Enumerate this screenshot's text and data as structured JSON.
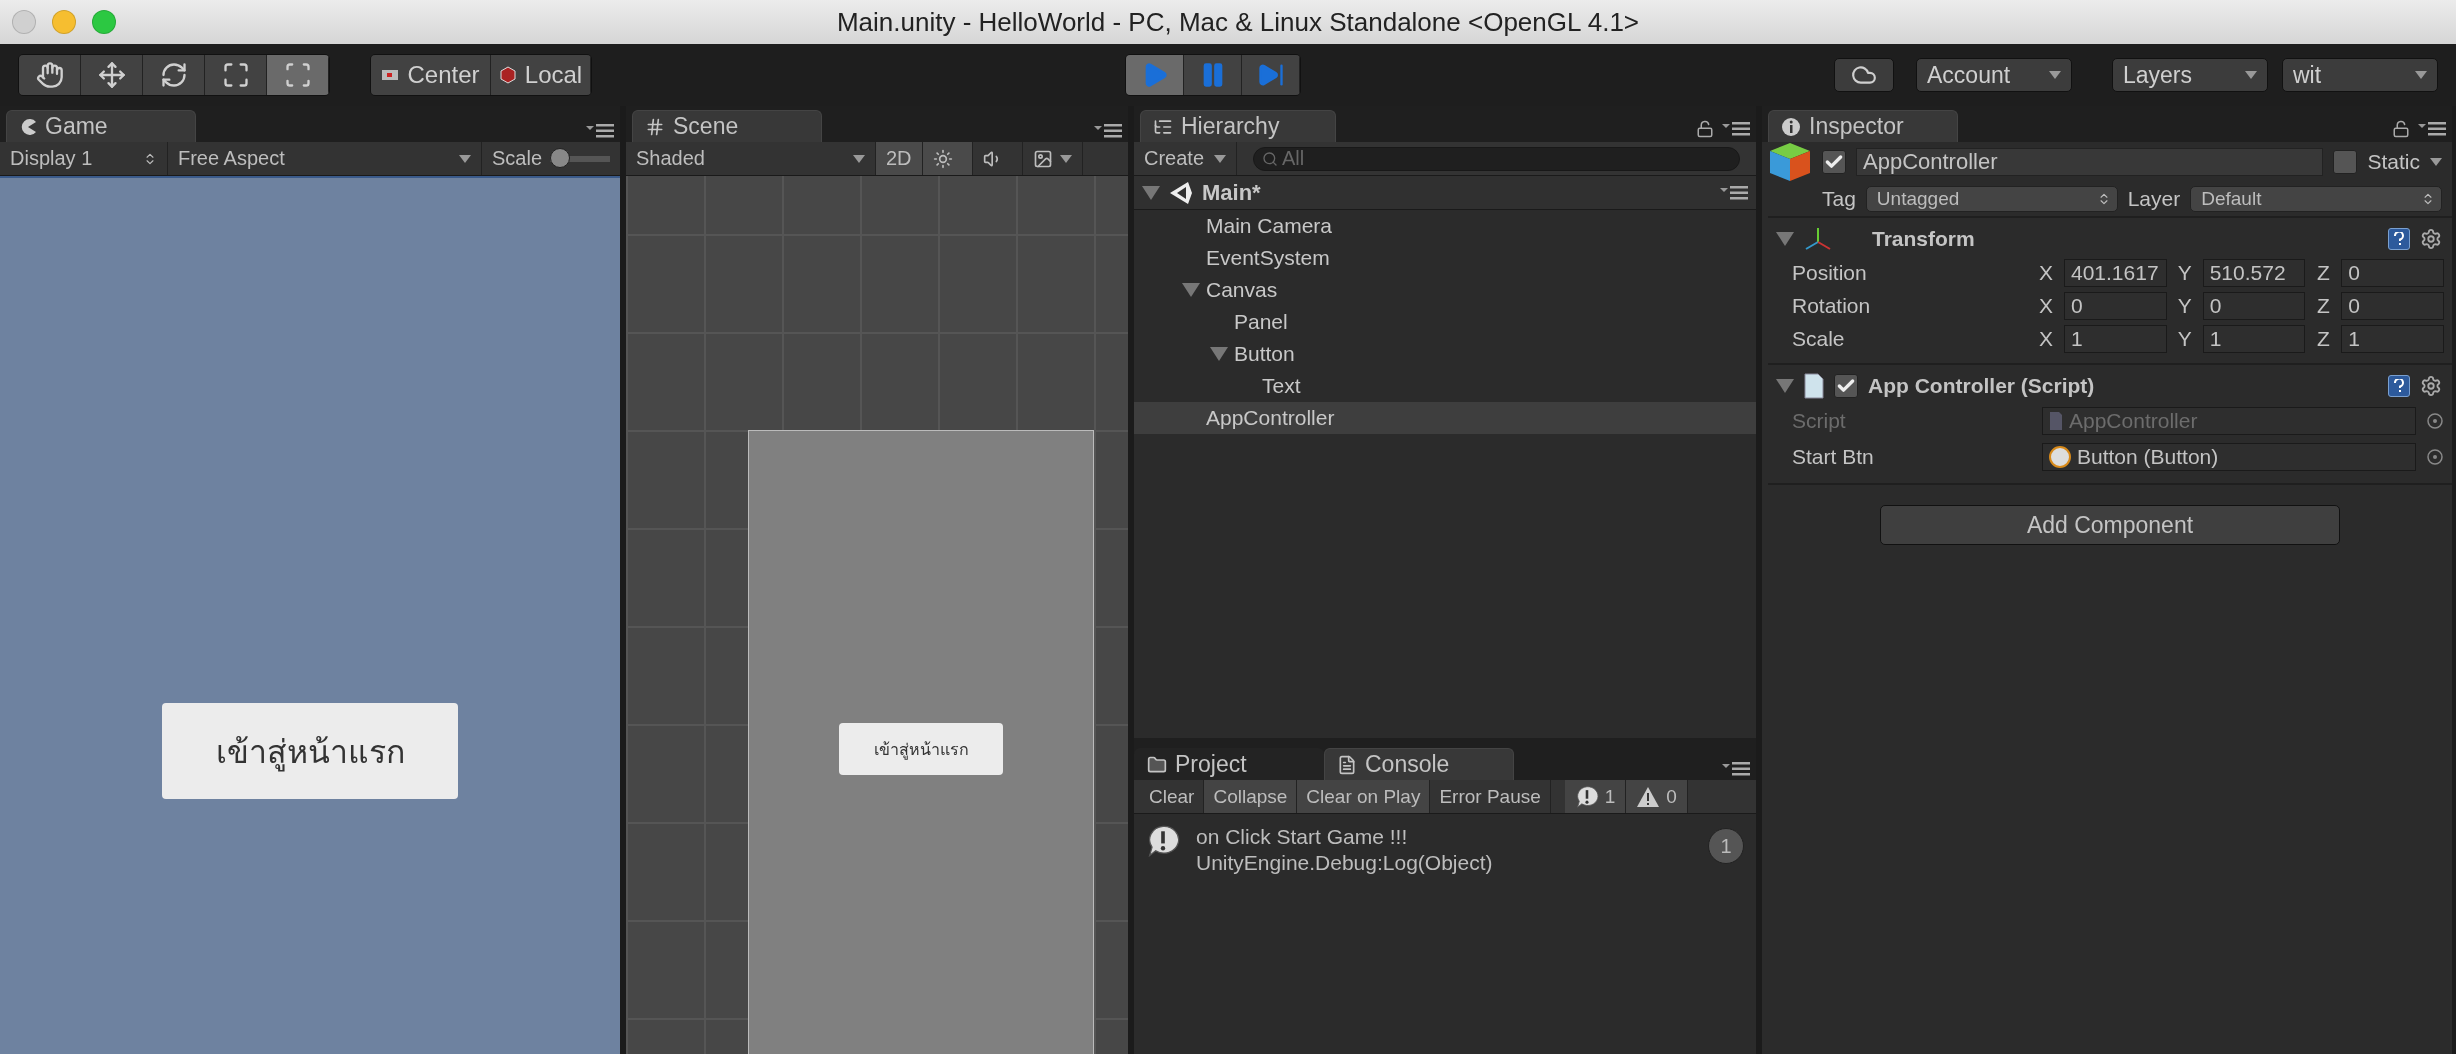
{
  "window": {
    "title": "Main.unity - HelloWorld - PC, Mac & Linux Standalone <OpenGL 4.1>"
  },
  "toolbar": {
    "tools": [
      {
        "kind": "hand",
        "selected": false
      },
      {
        "kind": "move",
        "selected": false
      },
      {
        "kind": "rotate",
        "selected": false
      },
      {
        "kind": "scale",
        "selected": false
      },
      {
        "kind": "rect",
        "selected": true
      }
    ],
    "pivot": [
      {
        "kind": "pivot",
        "label": "Center"
      },
      {
        "kind": "space",
        "label": "Local"
      }
    ],
    "playback": [
      {
        "kind": "play",
        "selected": true
      },
      {
        "kind": "pause",
        "selected": false
      },
      {
        "kind": "step",
        "selected": false
      }
    ],
    "account": "Account",
    "layers": "Layers",
    "layout": "wit"
  },
  "game": {
    "tab": "Game",
    "display": "Display 1",
    "aspect": "Free Aspect",
    "scale_label": "Scale",
    "scale": {
      "level": 0
    },
    "button_text": "เข้าสู่หน้าแรก"
  },
  "scene": {
    "tab": "Scene",
    "shading": "Shaded",
    "mode_2d": {
      "label": "2D",
      "selected": true
    },
    "lighting": {
      "selected": true
    },
    "audio": {
      "selected": false
    },
    "button_text": "เข้าสู่หน้าแรก"
  },
  "hierarchy": {
    "tab": "Hierarchy",
    "create": "Create",
    "search": {
      "placeholder": "All"
    },
    "scene": "Main*",
    "items": [
      {
        "label": "Main Camera",
        "selected": false
      },
      {
        "label": "EventSystem",
        "selected": false
      },
      {
        "label": "Canvas",
        "selected": false,
        "expanded": true,
        "children": [
          {
            "label": "Panel",
            "selected": false
          },
          {
            "label": "Button",
            "selected": false,
            "expanded": true,
            "children": [
              {
                "label": "Text",
                "selected": false
              }
            ]
          }
        ]
      },
      {
        "label": "AppController",
        "selected": true
      }
    ]
  },
  "console": {
    "tabs": [
      {
        "kind": "project",
        "label": "Project",
        "selected": false
      },
      {
        "kind": "console",
        "label": "Console",
        "selected": true
      }
    ],
    "buttons": [
      {
        "label": "Clear",
        "selected": false
      },
      {
        "label": "Collapse",
        "selected": true
      },
      {
        "label": "Clear on Play",
        "selected": true
      },
      {
        "label": "Error Pause",
        "selected": false
      }
    ],
    "counters": [
      {
        "kind": "log",
        "count": "1"
      },
      {
        "kind": "warning",
        "count": "0"
      }
    ],
    "entries": [
      {
        "kind": "log",
        "lines": [
          "on Click Start Game !!!",
          "UnityEngine.Debug:Log(Object)"
        ],
        "count": "1"
      }
    ]
  },
  "inspector": {
    "tab": "Inspector",
    "object": {
      "active": true,
      "name": "AppController",
      "static_label": "Static",
      "static": false,
      "tag_label": "Tag",
      "tag": "Untagged",
      "layer_label": "Layer",
      "layer": "Default"
    },
    "components": [
      {
        "kind": "transform",
        "title": "Transform",
        "rows": [
          {
            "label": "Position",
            "fields": [
              {
                "axis": "X",
                "value": "401.1617"
              },
              {
                "axis": "Y",
                "value": "510.572"
              },
              {
                "axis": "Z",
                "value": "0"
              }
            ]
          },
          {
            "label": "Rotation",
            "fields": [
              {
                "axis": "X",
                "value": "0"
              },
              {
                "axis": "Y",
                "value": "0"
              },
              {
                "axis": "Z",
                "value": "0"
              }
            ]
          },
          {
            "label": "Scale",
            "fields": [
              {
                "axis": "X",
                "value": "1"
              },
              {
                "axis": "Y",
                "value": "1"
              },
              {
                "axis": "Z",
                "value": "1"
              }
            ]
          }
        ]
      },
      {
        "kind": "script",
        "title": "App Controller (Script)",
        "enabled": true,
        "refs": [
          {
            "kind": "script",
            "label": "Script",
            "value": "AppController",
            "disabled": true
          },
          {
            "kind": "object",
            "label": "Start Btn",
            "value": "Button (Button)",
            "disabled": false
          }
        ]
      }
    ],
    "add_button": "Add Component"
  }
}
